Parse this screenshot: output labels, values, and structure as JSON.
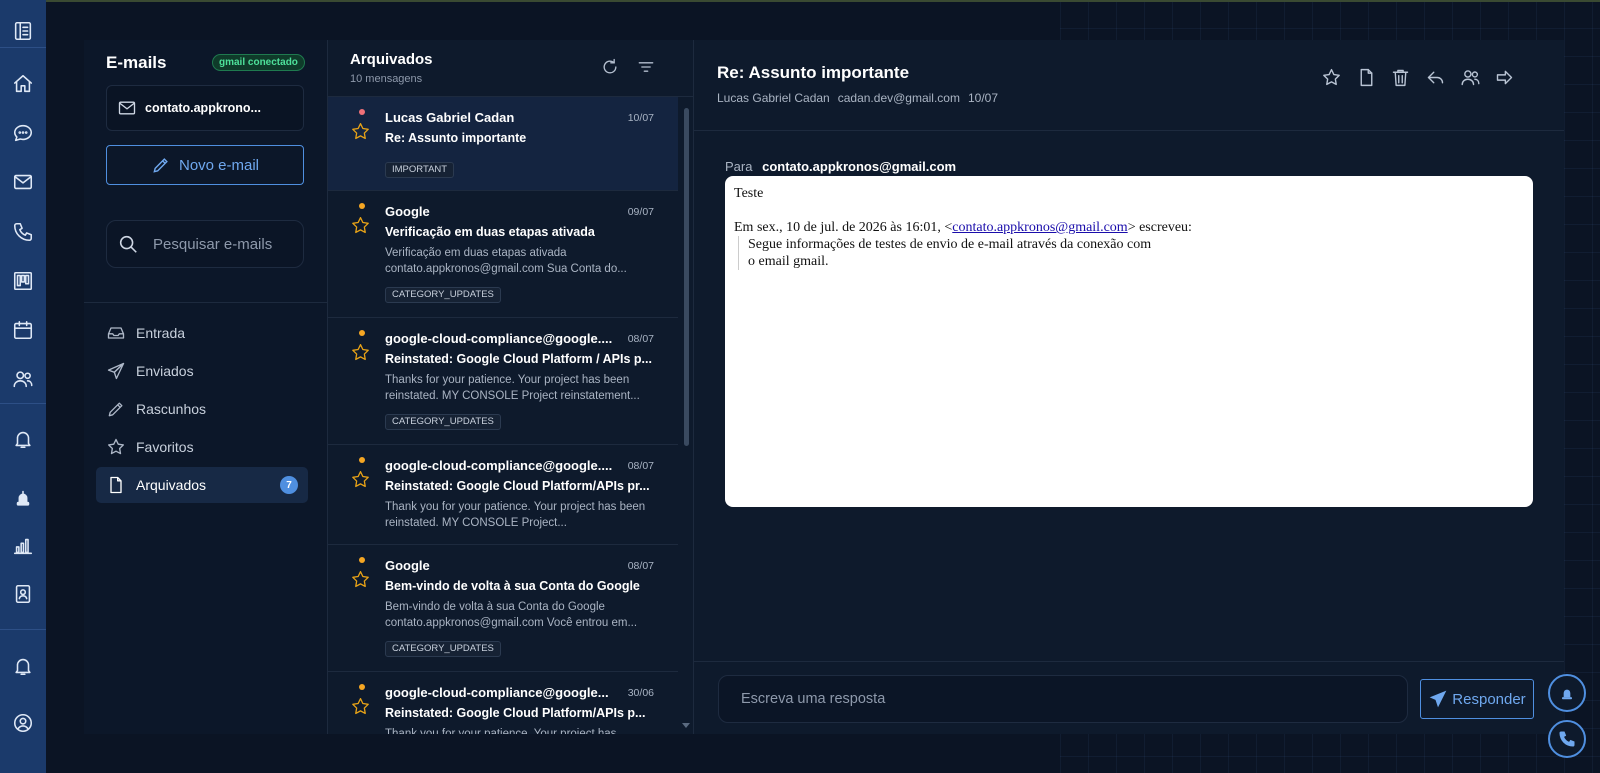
{
  "sidebar": {
    "title": "E-mails",
    "status_badge": "gmail conectado",
    "account": "contato.appkrono...",
    "new_email_label": "Novo e-mail",
    "search_placeholder": "Pesquisar e-mails",
    "folders": [
      {
        "label": "Entrada",
        "icon": "inbox-icon"
      },
      {
        "label": "Enviados",
        "icon": "send-icon"
      },
      {
        "label": "Rascunhos",
        "icon": "pencil-icon"
      },
      {
        "label": "Favoritos",
        "icon": "star-icon"
      },
      {
        "label": "Arquivados",
        "icon": "file-icon",
        "count": "7",
        "active": true
      }
    ]
  },
  "list": {
    "title": "Arquivados",
    "subtitle": "10 mensagens",
    "items": [
      {
        "from": "Lucas Gabriel Cadan",
        "date": "10/07",
        "subject": "Re: Assunto importante",
        "preview": "",
        "tag": "IMPORTANT",
        "dot_color": "#f07178",
        "selected": true
      },
      {
        "from": "Google",
        "date": "09/07",
        "subject": "Verificação em duas etapas ativada",
        "preview": "Verificação em duas etapas ativada contato.appkronos@gmail.com Sua Conta do...",
        "tag": "CATEGORY_UPDATES",
        "dot_color": "#f5a623"
      },
      {
        "from": "google-cloud-compliance@google....",
        "date": "08/07",
        "subject": "Reinstated: Google Cloud Platform / APIs p...",
        "preview": "Thanks for your patience. Your project has been reinstated. MY CONSOLE Project reinstatement...",
        "tag": "CATEGORY_UPDATES",
        "dot_color": "#f5a623"
      },
      {
        "from": "google-cloud-compliance@google....",
        "date": "08/07",
        "subject": "Reinstated: Google Cloud Platform/APIs pr...",
        "preview": "Thank you for your patience. Your project has been reinstated. MY CONSOLE Project...",
        "tag": "",
        "dot_color": "#f5a623"
      },
      {
        "from": "Google",
        "date": "08/07",
        "subject": "Bem-vindo de volta à sua Conta do Google",
        "preview": "Bem-vindo de volta à sua Conta do Google contato.appkronos@gmail.com Você entrou em...",
        "tag": "CATEGORY_UPDATES",
        "dot_color": "#f5a623"
      },
      {
        "from": "google-cloud-compliance@google...",
        "date": "30/06",
        "subject": "Reinstated: Google Cloud Platform/APIs p...",
        "preview": "Thank you for your patience. Your project has",
        "tag": "",
        "dot_color": "#f5a623"
      }
    ]
  },
  "reader": {
    "title": "Re: Assunto importante",
    "sender_name": "Lucas Gabriel Cadan",
    "sender_email": "cadan.dev@gmail.com",
    "date": "10/07",
    "to_label": "Para",
    "to_address": "contato.appkronos@gmail.com",
    "body_first": "Teste",
    "body_quote_intro_before": "Em sex., 10 de jul. de 2026 às 16:01, <",
    "body_quote_link": "contato.appkronos@gmail.com",
    "body_quote_intro_after": "> escreveu:",
    "body_quote_line1": "Segue informações de testes de envio de e-mail através da conexão com",
    "body_quote_line2": "o email gmail.",
    "reply_placeholder": "Escreva uma resposta",
    "reply_button": "Responder"
  },
  "colors": {
    "accent": "#4f8fe0",
    "rail": "#1b3a6b",
    "star": "#e8a317",
    "gmail_badge": "#4ee09a"
  }
}
